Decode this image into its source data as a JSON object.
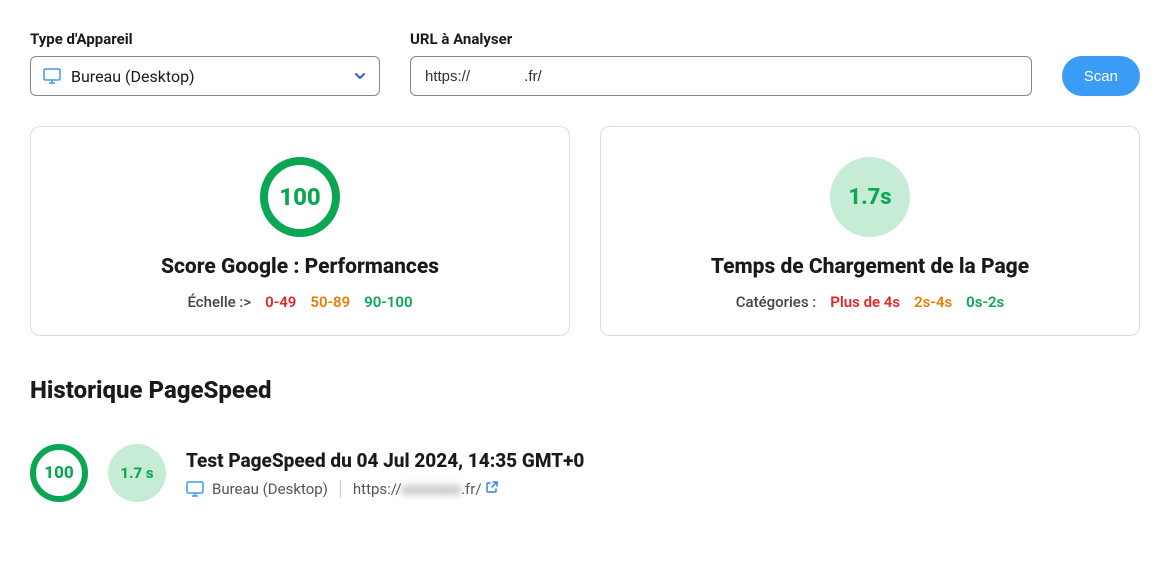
{
  "form": {
    "device_label": "Type d'Appareil",
    "device_value": "Bureau (Desktop)",
    "url_label": "URL à Analyser",
    "url_value": "https://             .fr/",
    "scan_label": "Scan"
  },
  "score_card": {
    "value": "100",
    "title": "Score Google : Performances",
    "scale_prefix": "Échelle :>",
    "scale_red": "0-49",
    "scale_orange": "50-89",
    "scale_green": "90-100"
  },
  "time_card": {
    "value": "1.7s",
    "title": "Temps de Chargement de la Page",
    "scale_prefix": "Catégories :",
    "scale_red": "Plus de 4s",
    "scale_orange": "2s-4s",
    "scale_green": "0s-2s"
  },
  "history": {
    "title": "Historique PageSpeed",
    "item": {
      "score": "100",
      "time": "1.7 s",
      "heading": "Test PageSpeed du 04 Jul 2024, 14:35 GMT+0",
      "device": "Bureau (Desktop)",
      "url_prefix": "https://",
      "url_blur": "xxxxxxxx",
      "url_suffix": ".fr/"
    }
  }
}
